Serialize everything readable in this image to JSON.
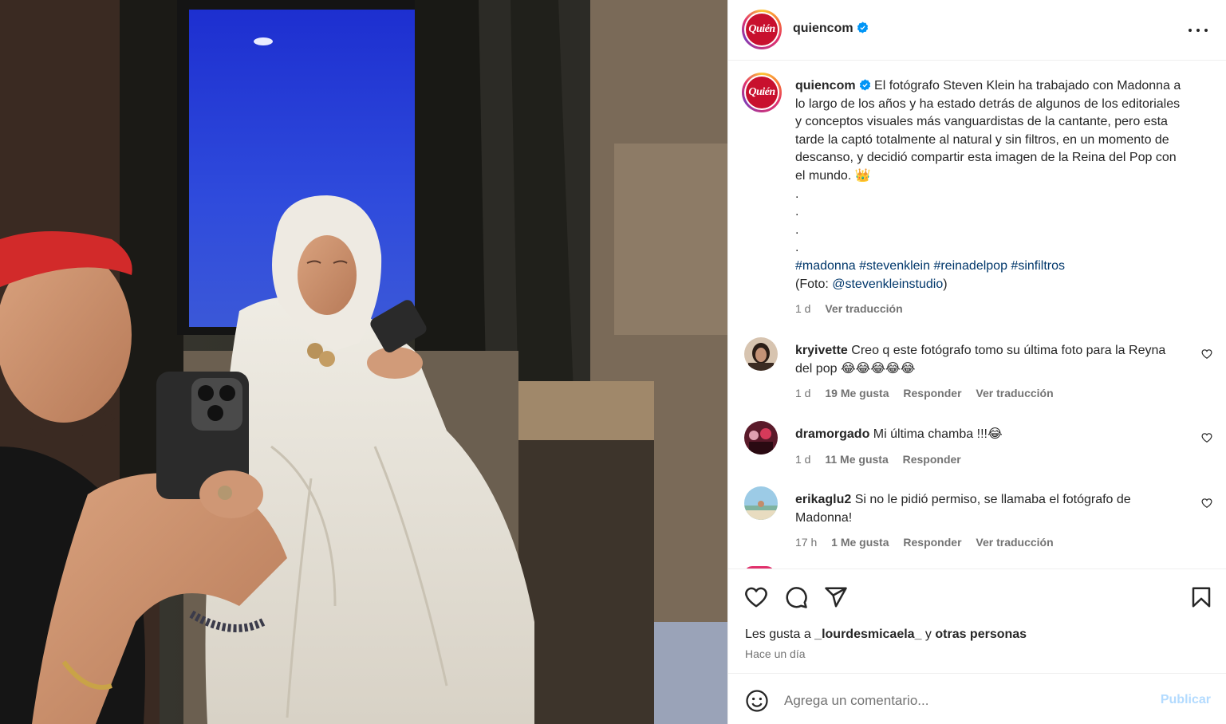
{
  "post": {
    "author": "quiencom",
    "avatar_text": "Quién",
    "caption": {
      "username": "quiencom",
      "text": "El fotógrafo Steven Klein ha trabajado con Madonna a lo largo de los años y ha estado detrás de algunos de los editoriales y conceptos visuales más vanguardistas de la cantante, pero esta tarde la captó totalmente al natural y sin filtros, en un momento de descanso, y decidió compartir esta imagen de la Reina del Pop con el mundo. 👑",
      "dots": [
        ".",
        ".",
        ".",
        "."
      ],
      "hashtags": "#madonna #stevenklein #reinadelpop #sinfiltros",
      "credit_prefix": "(Foto: ",
      "credit_handle": "@stevenkleinstudio",
      "credit_suffix": ")",
      "age": "1 d",
      "translate": "Ver traducción"
    },
    "comments": [
      {
        "username": "kryivette",
        "text": "Creo q este fotógrafo tomo su última foto para la Reyna del pop 😂😂😂😂😂",
        "age": "1 d",
        "likes": "19 Me gusta",
        "reply": "Responder",
        "translate": "Ver traducción"
      },
      {
        "username": "dramorgado",
        "text": "Mi última chamba !!!😂",
        "age": "1 d",
        "likes": "11 Me gusta",
        "reply": "Responder"
      },
      {
        "username": "erikaglu2",
        "text": "Si no le pidió permiso, se llamaba el fotógrafo de Madonna!",
        "age": "17 h",
        "likes": "1 Me gusta",
        "reply": "Responder",
        "translate": "Ver traducción"
      }
    ],
    "likes": {
      "prefix": "Les gusta a ",
      "user": "_lourdesmicaela_",
      "middle": " y ",
      "others": "otras personas"
    },
    "posted_time": "Hace un día",
    "comment_box": {
      "placeholder": "Agrega un comentario...",
      "publish": "Publicar"
    }
  },
  "colors": {
    "link": "#00376b",
    "verified": "#0095f6",
    "publish_disabled": "#b3dbff",
    "brand_red": "#c8102e"
  },
  "icons": [
    "more-icon",
    "verified-icon",
    "heart-icon",
    "comment-icon",
    "share-icon",
    "bookmark-icon",
    "emoji-icon"
  ]
}
